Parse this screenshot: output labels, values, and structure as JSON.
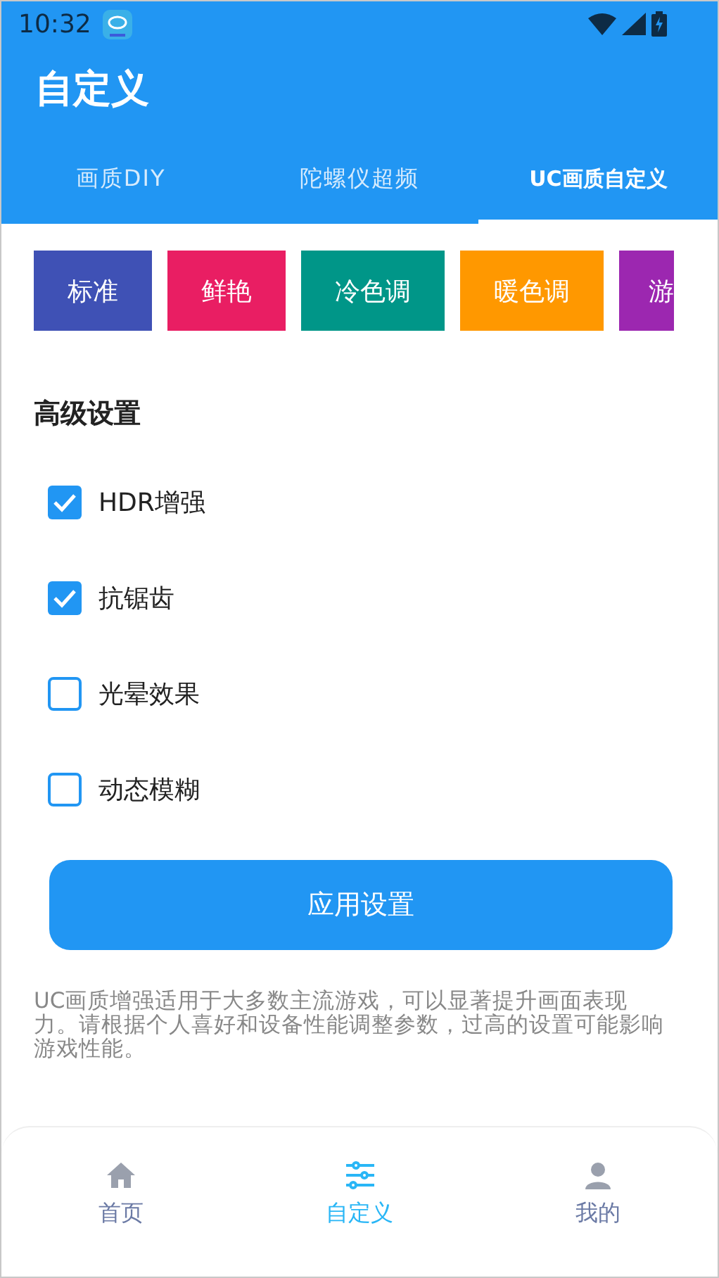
{
  "status_bar": {
    "time": "10:32"
  },
  "app_bar": {
    "title": "自定义"
  },
  "tabs": [
    {
      "label": "画质DIY",
      "selected": false
    },
    {
      "label": "陀螺仪超频",
      "selected": false
    },
    {
      "label": "UC画质自定义",
      "selected": true
    }
  ],
  "presets": [
    {
      "label": "标准",
      "color": "#3f51b5"
    },
    {
      "label": "鲜艳",
      "color": "#e91e63"
    },
    {
      "label": "冷色调",
      "color": "#009688"
    },
    {
      "label": "暖色调",
      "color": "#ff9800"
    },
    {
      "label": "游",
      "color": "#9c27b0"
    }
  ],
  "advanced": {
    "title": "高级设置",
    "options": [
      {
        "label": "HDR增强",
        "checked": true
      },
      {
        "label": "抗锯齿",
        "checked": true
      },
      {
        "label": "光晕效果",
        "checked": false
      },
      {
        "label": "动态模糊",
        "checked": false
      }
    ]
  },
  "apply_button": "应用设置",
  "note": "UC画质增强适用于大多数主流游戏，可以显著提升画面表现力。请根据个人喜好和设备性能调整参数，过高的设置可能影响游戏性能。",
  "bottom_nav": [
    {
      "label": "首页",
      "kind": "home",
      "selected": false
    },
    {
      "label": "自定义",
      "kind": "tune",
      "selected": true
    },
    {
      "label": "我的",
      "kind": "person",
      "selected": false
    }
  ]
}
